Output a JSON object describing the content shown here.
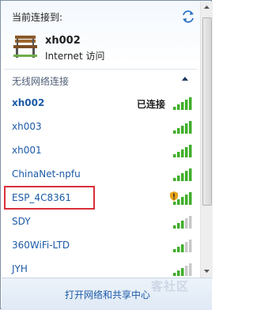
{
  "header": {
    "title": "当前连接到:"
  },
  "current": {
    "name": "xh002",
    "access": "Internet 访问"
  },
  "section": {
    "label": "无线网络连接"
  },
  "networks": [
    {
      "name": "xh002",
      "status": "已连接",
      "bold": true,
      "signal": 5,
      "secured": false
    },
    {
      "name": "xh003",
      "signal": 5,
      "secured": false
    },
    {
      "name": "xh001",
      "signal": 5,
      "secured": false
    },
    {
      "name": "ChinaNet-npfu",
      "signal": 5,
      "secured": false
    },
    {
      "name": "ESP_4C8361",
      "signal": 5,
      "secured": true,
      "highlighted": true
    },
    {
      "name": "SDY",
      "signal": 3,
      "secured": false
    },
    {
      "name": "360WiFi-LTD",
      "signal": 3,
      "secured": false
    },
    {
      "name": "JYH",
      "signal": 3,
      "secured": false
    }
  ],
  "footer": {
    "link": "打开网络和共享中心"
  },
  "watermark": "客社区",
  "colors": {
    "link": "#1c5aa6",
    "signal_active": "#3fae29",
    "signal_inactive": "#c8c8c8",
    "highlight": "#d9303a"
  }
}
